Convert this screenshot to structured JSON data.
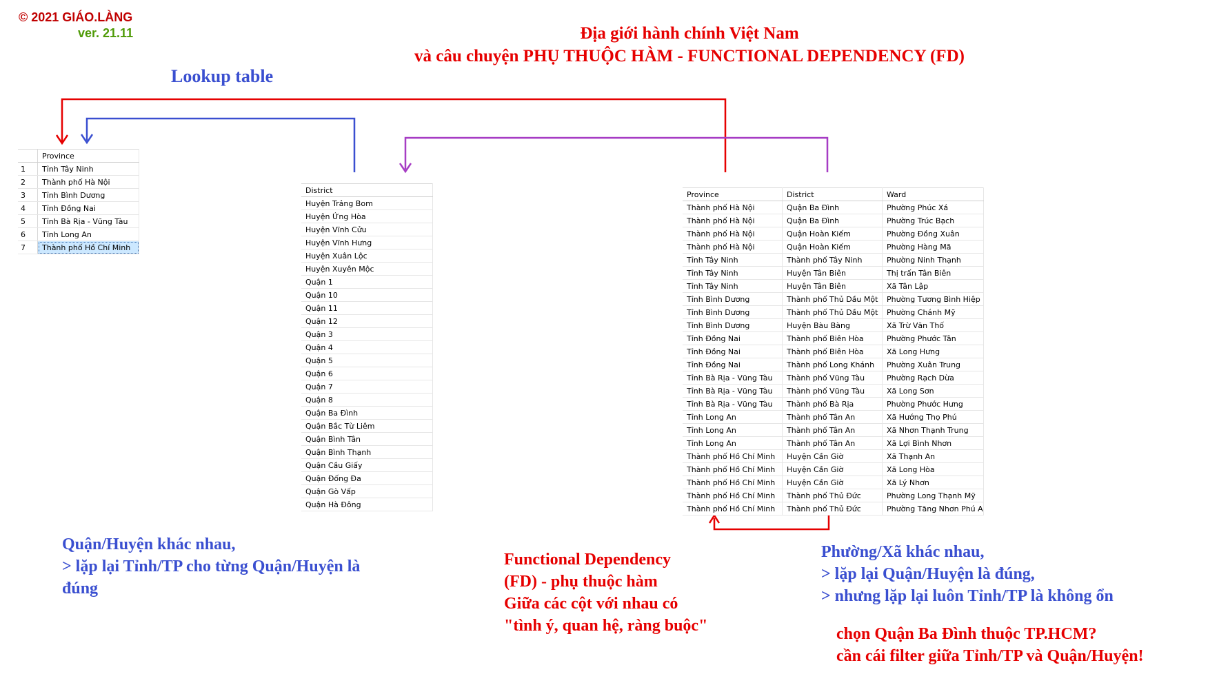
{
  "header": {
    "copyright": "© 2021 GIÁO.LÀNG",
    "version": "ver. 21.11",
    "title_line1": "Địa giới hành chính Việt Nam",
    "title_line2": "và câu chuyện PHỤ THUỘC HÀM - FUNCTIONAL DEPENDENCY (FD)",
    "lookup_label": "Lookup table"
  },
  "colors": {
    "red": "#e60000",
    "blue": "#3a4fd0",
    "purple": "#a63cc4",
    "selection": "#cce8ff"
  },
  "province_table": {
    "header": "Province",
    "selected_row": 7,
    "rows": [
      {
        "n": "1",
        "province": "Tỉnh Tây Ninh"
      },
      {
        "n": "2",
        "province": "Thành phố Hà Nội"
      },
      {
        "n": "3",
        "province": "Tỉnh Bình Dương"
      },
      {
        "n": "4",
        "province": "Tỉnh Đồng Nai"
      },
      {
        "n": "5",
        "province": "Tỉnh Bà Rịa - Vũng Tàu"
      },
      {
        "n": "6",
        "province": "Tỉnh Long An"
      },
      {
        "n": "7",
        "province": "Thành phố Hồ Chí Minh"
      }
    ]
  },
  "district_table": {
    "header": "District",
    "rows": [
      "Huyện Trảng Bom",
      "Huyện Ứng Hòa",
      "Huyện Vĩnh Cửu",
      "Huyện Vĩnh Hưng",
      "Huyện Xuân Lộc",
      "Huyện Xuyên Mộc",
      "Quận 1",
      "Quận 10",
      "Quận 11",
      "Quận 12",
      "Quận 3",
      "Quận 4",
      "Quận 5",
      "Quận 6",
      "Quận 7",
      "Quận 8",
      "Quận Ba Đình",
      "Quận Bắc Từ Liêm",
      "Quận Bình Tân",
      "Quận Bình Thạnh",
      "Quận Cầu Giấy",
      "Quận Đống Đa",
      "Quận Gò Vấp",
      "Quận Hà Đông"
    ]
  },
  "ward_table": {
    "headers": [
      "Province",
      "District",
      "Ward"
    ],
    "rows": [
      [
        "Thành phố Hà Nội",
        "Quận Ba Đình",
        "Phường Phúc Xá"
      ],
      [
        "Thành phố Hà Nội",
        "Quận Ba Đình",
        "Phường Trúc Bạch"
      ],
      [
        "Thành phố Hà Nội",
        "Quận Hoàn Kiếm",
        "Phường Đồng Xuân"
      ],
      [
        "Thành phố Hà Nội",
        "Quận Hoàn Kiếm",
        "Phường Hàng Mã"
      ],
      [
        "Tỉnh Tây Ninh",
        "Thành phố Tây Ninh",
        "Phường Ninh Thạnh"
      ],
      [
        "Tỉnh Tây Ninh",
        "Huyện Tân Biên",
        "Thị trấn Tân Biên"
      ],
      [
        "Tỉnh Tây Ninh",
        "Huyện Tân Biên",
        "Xã Tân Lập"
      ],
      [
        "Tỉnh Bình Dương",
        "Thành phố Thủ Dầu Một",
        "Phường Tương Bình Hiệp"
      ],
      [
        "Tỉnh Bình Dương",
        "Thành phố Thủ Dầu Một",
        "Phường Chánh Mỹ"
      ],
      [
        "Tỉnh Bình Dương",
        "Huyện Bàu Bàng",
        "Xã Trừ Văn Thố"
      ],
      [
        "Tỉnh Đồng Nai",
        "Thành phố Biên Hòa",
        "Phường Phước Tân"
      ],
      [
        "Tỉnh Đồng Nai",
        "Thành phố Biên Hòa",
        "Xã Long Hưng"
      ],
      [
        "Tỉnh Đồng Nai",
        "Thành phố Long Khánh",
        "Phường Xuân Trung"
      ],
      [
        "Tỉnh Bà Rịa - Vũng Tàu",
        "Thành phố Vũng Tàu",
        "Phường Rạch Dừa"
      ],
      [
        "Tỉnh Bà Rịa - Vũng Tàu",
        "Thành phố Vũng Tàu",
        "Xã Long Sơn"
      ],
      [
        "Tỉnh Bà Rịa - Vũng Tàu",
        "Thành phố Bà Rịa",
        "Phường Phước Hưng"
      ],
      [
        "Tỉnh Long An",
        "Thành phố Tân An",
        "Xã Hướng Thọ Phú"
      ],
      [
        "Tỉnh Long An",
        "Thành phố Tân An",
        "Xã Nhơn Thạnh Trung"
      ],
      [
        "Tỉnh Long An",
        "Thành phố Tân An",
        "Xã Lợi Bình Nhơn"
      ],
      [
        "Thành phố Hồ Chí Minh",
        "Huyện Cần Giờ",
        "Xã Thạnh An"
      ],
      [
        "Thành phố Hồ Chí Minh",
        "Huyện Cần Giờ",
        "Xã Long Hòa"
      ],
      [
        "Thành phố Hồ Chí Minh",
        "Huyện Cần Giờ",
        "Xã Lý Nhơn"
      ],
      [
        "Thành phố Hồ Chí Minh",
        "Thành phố Thủ Đức",
        "Phường Long Thạnh Mỹ"
      ],
      [
        "Thành phố Hồ Chí Minh",
        "Thành phố Thủ Đức",
        "Phường Tăng Nhơn Phú A"
      ]
    ]
  },
  "notes": {
    "district_note": [
      "Quận/Huyện khác nhau,",
      "> lặp lại Tỉnh/TP cho từng Quận/Huyện là",
      "đúng"
    ],
    "fd_note": [
      "Functional Dependency",
      "(FD) - phụ thuộc hàm",
      "Giữa các cột với nhau có",
      "\"tình ý, quan hệ, ràng buộc\""
    ],
    "ward_note": [
      "Phường/Xã khác nhau,",
      "> lặp lại Quận/Huyện là đúng,",
      "> nhưng lặp lại luôn Tỉnh/TP là không ổn"
    ],
    "filter_note": [
      "chọn Quận Ba Đình thuộc TP.HCM?",
      "cần cái filter giữa Tỉnh/TP và Quận/Huyện!"
    ]
  }
}
